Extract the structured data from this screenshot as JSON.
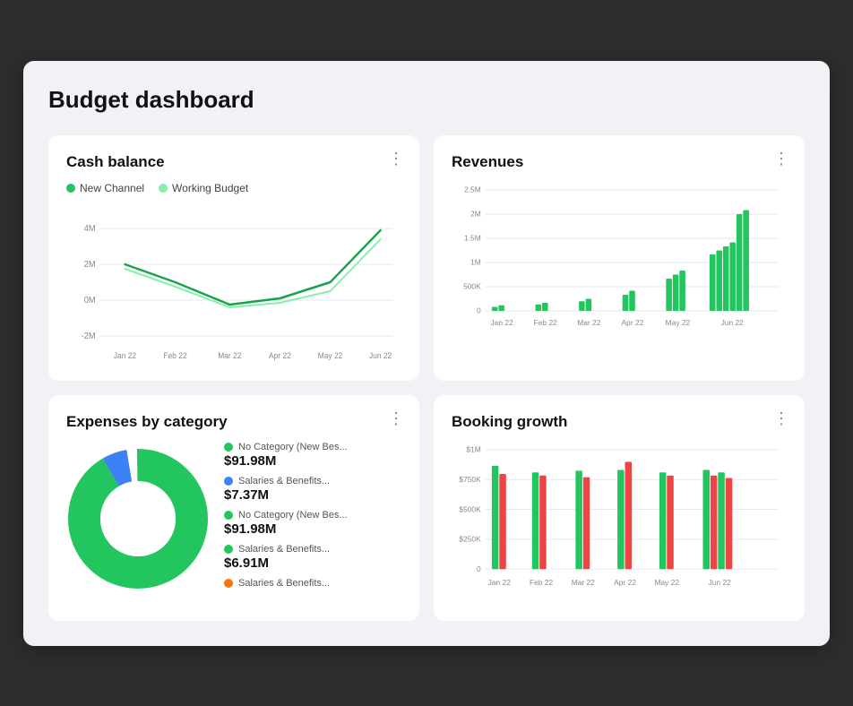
{
  "page": {
    "title": "Budget dashboard"
  },
  "cards": {
    "cash_balance": {
      "title": "Cash balance",
      "legend": [
        {
          "label": "New Channel",
          "color": "#22c55e"
        },
        {
          "label": "Working Budget",
          "color": "#86efac"
        }
      ],
      "y_labels": [
        "4M",
        "2M",
        "0M",
        "-2M"
      ],
      "x_labels": [
        "Jan 22",
        "Feb 22",
        "Mar 22",
        "Apr 22",
        "May 22",
        "Jun 22"
      ],
      "menu": "⋮"
    },
    "revenues": {
      "title": "Revenues",
      "y_labels": [
        "2.5M",
        "2M",
        "1.5M",
        "1M",
        "500K",
        "0"
      ],
      "x_labels": [
        "Jan 22",
        "Feb 22",
        "Mar 22",
        "Apr 22",
        "May 22",
        "Jun 22"
      ],
      "menu": "⋮"
    },
    "expenses": {
      "title": "Expenses by category",
      "menu": "⋮",
      "items": [
        {
          "label": "No Category (New Bes...",
          "value": "$91.98M",
          "color": "#22c55e"
        },
        {
          "label": "Salaries & Benefits...",
          "value": "$7.37M",
          "color": "#3b82f6"
        },
        {
          "label": "No Category (New Bes...",
          "value": "$91.98M",
          "color": "#22c55e"
        },
        {
          "label": "Salaries & Benefits...",
          "value": "$6.91M",
          "color": "#22c55e"
        },
        {
          "label": "Salaries & Benefits...",
          "value": "",
          "color": "#f97316"
        }
      ]
    },
    "booking": {
      "title": "Booking growth",
      "y_labels": [
        "$1M",
        "$750K",
        "$500K",
        "$250K",
        "0"
      ],
      "x_labels": [
        "Jan 22",
        "Feb 22",
        "Mar 22",
        "Apr 22",
        "May 22",
        "Jun 22"
      ],
      "menu": "⋮"
    }
  }
}
